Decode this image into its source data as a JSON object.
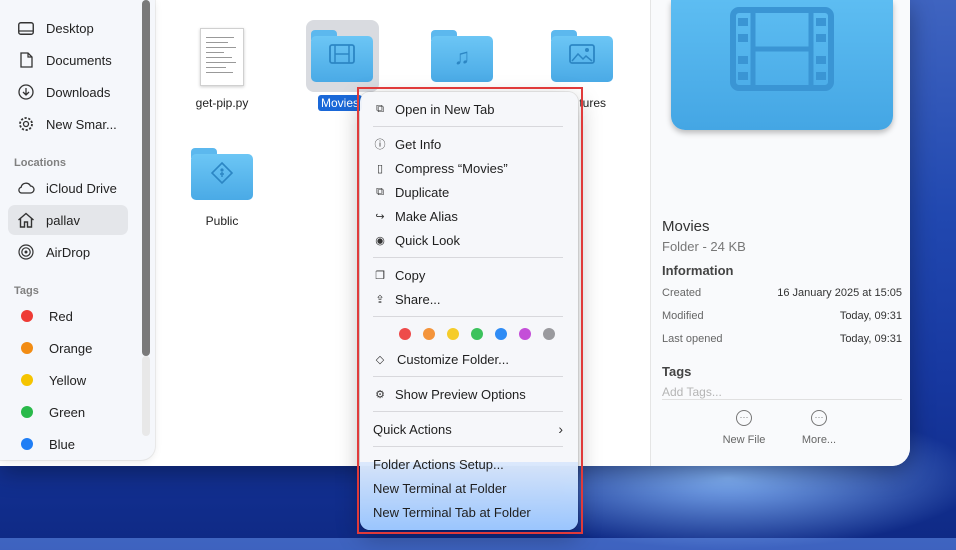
{
  "sidebar": {
    "favorites": [
      {
        "label": "Desktop",
        "icon": "desktop-icon"
      },
      {
        "label": "Documents",
        "icon": "document-icon"
      },
      {
        "label": "Downloads",
        "icon": "download-icon"
      },
      {
        "label": "New Smar...",
        "icon": "gear-icon"
      }
    ],
    "locations_heading": "Locations",
    "locations": [
      {
        "label": "iCloud Drive",
        "icon": "cloud-icon"
      },
      {
        "label": "pallav",
        "icon": "home-icon"
      },
      {
        "label": "AirDrop",
        "icon": "airdrop-icon"
      }
    ],
    "tags_heading": "Tags",
    "tags": [
      {
        "label": "Red",
        "color": "#ee3b35"
      },
      {
        "label": "Orange",
        "color": "#f28c13"
      },
      {
        "label": "Yellow",
        "color": "#f5c400"
      },
      {
        "label": "Green",
        "color": "#29b94a"
      },
      {
        "label": "Blue",
        "color": "#1f7ef5"
      }
    ]
  },
  "files": [
    {
      "name": "get-pip.py"
    },
    {
      "name": "Movies"
    },
    {
      "name": ""
    },
    {
      "name": "tures"
    },
    {
      "name": "Public"
    }
  ],
  "preview": {
    "title": "Movies",
    "subtitle": "Folder - 24 KB",
    "info_heading": "Information",
    "rows": [
      {
        "label": "Created",
        "value": "16 January 2025 at 15:05"
      },
      {
        "label": "Modified",
        "value": "Today, 09:31"
      },
      {
        "label": "Last opened",
        "value": "Today, 09:31"
      }
    ],
    "tags_heading": "Tags",
    "tags_placeholder": "Add Tags...",
    "actions": [
      "New File",
      "More..."
    ]
  },
  "context_menu": {
    "items": [
      {
        "label": "Open in New Tab",
        "icon": "open-tab-icon"
      },
      {
        "label": "Get Info",
        "icon": "info-icon"
      },
      {
        "label": "Compress “Movies”",
        "icon": "compress-icon"
      },
      {
        "label": "Duplicate",
        "icon": "duplicate-icon"
      },
      {
        "label": "Make Alias",
        "icon": "alias-icon"
      },
      {
        "label": "Quick Look",
        "icon": "eye-icon"
      },
      {
        "label": "Copy",
        "icon": "copy-icon"
      },
      {
        "label": "Share...",
        "icon": "share-icon"
      },
      {
        "label": "Customize Folder...",
        "icon": "tag-icon"
      },
      {
        "label": "Show Preview Options",
        "icon": "gear-icon"
      },
      {
        "label": "Quick Actions",
        "icon": ""
      },
      {
        "label": "Folder Actions Setup...",
        "icon": ""
      },
      {
        "label": "New Terminal at Folder",
        "icon": ""
      },
      {
        "label": "New Terminal Tab at Folder",
        "icon": ""
      }
    ],
    "tag_colors": [
      "#ee4b4b",
      "#f4943b",
      "#f5cc2a",
      "#3cc25c",
      "#2f8cf5",
      "#c44fd8",
      "#9a9a9e"
    ]
  }
}
